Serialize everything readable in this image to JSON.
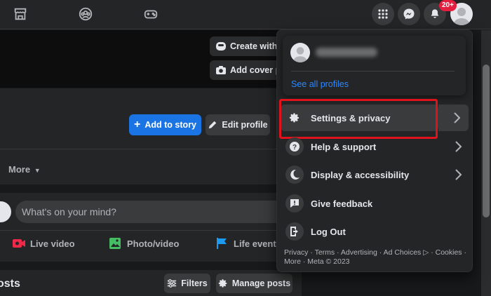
{
  "topnav": {
    "notifications_badge": "20+",
    "icons": [
      "marketplace-icon",
      "groups-icon",
      "gaming-icon",
      "menu-grid-icon",
      "messenger-icon",
      "bell-icon"
    ]
  },
  "cover": {
    "create_with_label": "Create with a",
    "add_cover_label": "Add cover ph"
  },
  "profile": {
    "add_story_label": "Add to story",
    "edit_profile_label": "Edit profile",
    "more_label": "More"
  },
  "composer": {
    "placeholder": "What's on your mind?",
    "live_video": "Live video",
    "photo_video": "Photo/video",
    "life_event": "Life event"
  },
  "posts": {
    "title": "osts",
    "filters_label": "Filters",
    "manage_label": "Manage posts"
  },
  "menu": {
    "see_all_profiles": "See all profiles",
    "items": [
      {
        "label": "Settings & privacy",
        "icon": "gear-icon",
        "has_chevron": true
      },
      {
        "label": "Help & support",
        "icon": "help-icon",
        "has_chevron": true
      },
      {
        "label": "Display & accessibility",
        "icon": "moon-icon",
        "has_chevron": true
      },
      {
        "label": "Give feedback",
        "icon": "feedback-icon",
        "has_chevron": false
      },
      {
        "label": "Log Out",
        "icon": "logout-icon",
        "has_chevron": false
      }
    ],
    "footer_line1": "Privacy · Terms · Advertising · Ad Choices ▷ · Cookies ·",
    "footer_line2": "More · Meta © 2023"
  },
  "colors": {
    "accent": "#1b74e4",
    "link": "#2d88ff",
    "badge": "#e41e3f",
    "highlight": "#e0121b"
  }
}
